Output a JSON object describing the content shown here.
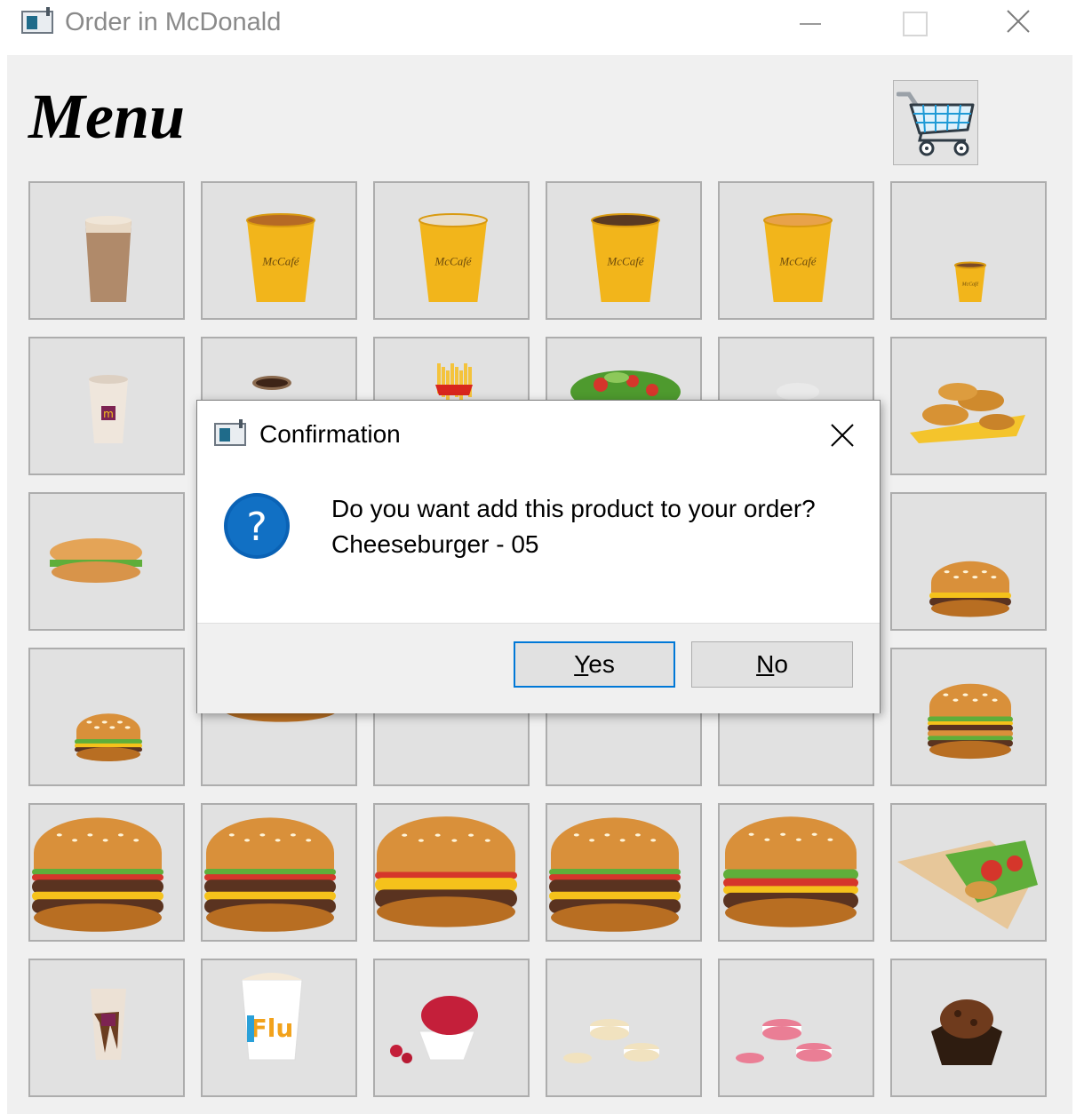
{
  "window": {
    "title": "Order in McDonald"
  },
  "main": {
    "heading": "Menu",
    "cart_icon": "shopping-cart-icon"
  },
  "menu_items": [
    {
      "icon": "latte-cup-icon",
      "kind": "tall-cup"
    },
    {
      "icon": "mccafe-tea-icon",
      "kind": "mccafe-tea"
    },
    {
      "icon": "mccafe-cappuccino-icon",
      "kind": "mccafe-cappuccino"
    },
    {
      "icon": "mccafe-coffee-icon",
      "kind": "mccafe-coffee"
    },
    {
      "icon": "mccafe-caramel-icon",
      "kind": "mccafe-caramel"
    },
    {
      "icon": "espresso-cup-icon",
      "kind": "mccafe-small"
    },
    {
      "icon": "milkshake-icon",
      "kind": "shake"
    },
    {
      "icon": "hot-chocolate-icon",
      "kind": "cocoa"
    },
    {
      "icon": "french-fries-icon",
      "kind": "fries"
    },
    {
      "icon": "salad-icon",
      "kind": "salad"
    },
    {
      "icon": "dip-sauce-icon",
      "kind": "faint"
    },
    {
      "icon": "chicken-strips-icon",
      "kind": "strips"
    },
    {
      "icon": "chicken-sandwich-icon",
      "kind": "long-sandwich"
    },
    {
      "icon": "hidden-item-icon",
      "kind": "hidden"
    },
    {
      "icon": "hidden-item-icon",
      "kind": "hidden"
    },
    {
      "icon": "hidden-item-icon",
      "kind": "hidden"
    },
    {
      "icon": "hidden-item-icon",
      "kind": "hidden"
    },
    {
      "icon": "cheeseburger-icon",
      "kind": "cheeseburger"
    },
    {
      "icon": "chicken-burger-icon",
      "kind": "small-burger"
    },
    {
      "icon": "chicken-burger-icon",
      "kind": "big-lettuce"
    },
    {
      "icon": "chicken-burger-icon",
      "kind": "crispy"
    },
    {
      "icon": "bacon-burger-icon",
      "kind": "bacon"
    },
    {
      "icon": "bacon-burger-icon",
      "kind": "bacon2"
    },
    {
      "icon": "big-mac-icon",
      "kind": "bigmac"
    },
    {
      "icon": "double-burger-icon",
      "kind": "double"
    },
    {
      "icon": "double-burger-icon",
      "kind": "double2"
    },
    {
      "icon": "quarter-pounder-icon",
      "kind": "single-cheese"
    },
    {
      "icon": "double-burger-icon",
      "kind": "double3"
    },
    {
      "icon": "tomato-burger-icon",
      "kind": "tomato"
    },
    {
      "icon": "wrap-icon",
      "kind": "wrap"
    },
    {
      "icon": "milkshake-icon",
      "kind": "choc-shake"
    },
    {
      "icon": "mcflurry-icon",
      "kind": "mcflurry"
    },
    {
      "icon": "raspberry-dessert-icon",
      "kind": "raspberry"
    },
    {
      "icon": "vanilla-macaron-icon",
      "kind": "macaron-v"
    },
    {
      "icon": "pink-macaron-icon",
      "kind": "macaron-p"
    },
    {
      "icon": "muffin-icon",
      "kind": "muffin"
    }
  ],
  "dialog": {
    "title": "Confirmation",
    "icon": "question-icon",
    "message_line1": "Do you want add this product to your order?",
    "message_line2": "Cheeseburger - 05",
    "yes_mnemonic": "Y",
    "yes_rest": "es",
    "no_mnemonic": "N",
    "no_rest": "o"
  },
  "colors": {
    "accent": "#0078d7",
    "dialog_bg": "#ffffff",
    "client_bg": "#f0f0f0",
    "tile_bg": "#e1e1e1",
    "mccafe_yellow": "#f2b51b"
  }
}
